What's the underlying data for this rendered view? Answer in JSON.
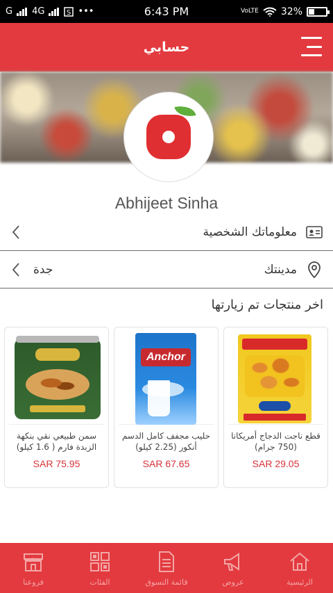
{
  "status_bar": {
    "carrier": "G",
    "network": "4G",
    "more": "•••",
    "time": "6:43 PM",
    "volte": "VoLTE",
    "battery": "32%",
    "battery_level": 0.32
  },
  "app_bar": {
    "title": "حسابي"
  },
  "profile": {
    "name": "Abhijeet Sinha"
  },
  "rows": {
    "personal_info_label": "معلوماتك الشخصية",
    "city_label": "مدينتك",
    "city_value": "جدة"
  },
  "recent": {
    "title": "اخر منتجات تم زيارتها",
    "products": [
      {
        "name": "قطع ناجت الدجاج أمريكانا (750 جرام)",
        "price": "SAR 29.05"
      },
      {
        "name": "حليب مجفف كامل الدسم أنكور (2.25 كيلو)",
        "price": "SAR 67.65",
        "brand": "Anchor"
      },
      {
        "name": "سمن طبيعي نقي بنكهة الزبدة فارم ( 1.6 كيلو)",
        "price": "SAR 75.95"
      }
    ]
  },
  "bottom_nav": [
    {
      "label": "الرئيسية",
      "icon": "home-icon"
    },
    {
      "label": "عروض",
      "icon": "megaphone-icon"
    },
    {
      "label": "قائمة التسوق",
      "icon": "list-document-icon"
    },
    {
      "label": "الفئات",
      "icon": "categories-icon"
    },
    {
      "label": "فروعنا",
      "icon": "store-icon"
    }
  ],
  "colors": {
    "primary": "#e33a3f",
    "price": "#d6333a"
  }
}
